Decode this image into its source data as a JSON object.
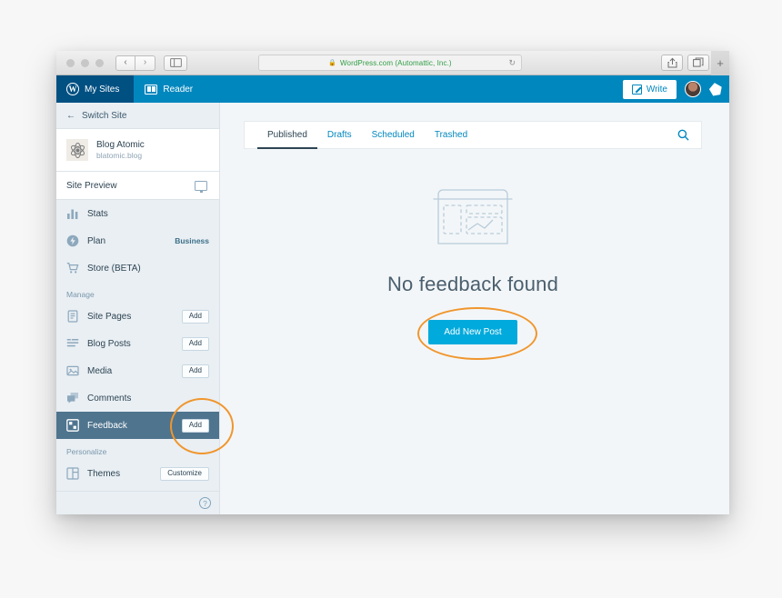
{
  "browser": {
    "url_text": "WordPress.com (Automattic, Inc.)",
    "lock_icon": "lock-icon",
    "reload_glyph": "↻",
    "back_glyph": "‹",
    "forward_glyph": "›",
    "new_tab_glyph": "+",
    "traffic_lights": [
      "close",
      "minimize",
      "zoom"
    ],
    "sidebar_toggle_icon": "sidebar-toggle-icon",
    "share_icon": "share-icon",
    "tabs_overview_icon": "tabs-overview-icon"
  },
  "masthead": {
    "my_sites_label": "My Sites",
    "reader_label": "Reader",
    "write_label": "Write",
    "wp_logo_glyph": "W",
    "avatar_name": "avatar",
    "notifications_name": "notifications-icon",
    "background_color": "#0087be",
    "active_background_color": "#005082"
  },
  "sidebar": {
    "switch_site_label": "Switch Site",
    "back_arrow_glyph": "←",
    "site": {
      "title": "Blog Atomic",
      "url": "blatomic.blog",
      "icon_name": "site-atom-icon"
    },
    "site_preview_label": "Site Preview",
    "primary_items": [
      {
        "label": "Stats",
        "icon": "stats-icon",
        "meta": ""
      },
      {
        "label": "Plan",
        "icon": "plan-icon",
        "meta": "Business"
      },
      {
        "label": "Store (BETA)",
        "icon": "store-icon",
        "meta": ""
      }
    ],
    "manage_section_label": "Manage",
    "manage_items": [
      {
        "label": "Site Pages",
        "icon": "page-icon",
        "action": "Add"
      },
      {
        "label": "Blog Posts",
        "icon": "posts-icon",
        "action": "Add"
      },
      {
        "label": "Media",
        "icon": "media-icon",
        "action": "Add"
      },
      {
        "label": "Comments",
        "icon": "comments-icon",
        "action": ""
      },
      {
        "label": "Feedback",
        "icon": "feedback-icon",
        "action": "Add"
      }
    ],
    "selected_item": "Feedback",
    "personalize_section_label": "Personalize",
    "personalize_items": [
      {
        "label": "Themes",
        "icon": "themes-icon",
        "action": "Customize"
      }
    ],
    "help_glyph": "?",
    "selected_background_color": "#4f748e"
  },
  "main": {
    "tabs": [
      {
        "label": "Published",
        "active": true
      },
      {
        "label": "Drafts",
        "active": false
      },
      {
        "label": "Scheduled",
        "active": false
      },
      {
        "label": "Trashed",
        "active": false
      }
    ],
    "search_icon": "search-icon",
    "empty_state": {
      "illustration_name": "empty-document-illustration",
      "title": "No feedback found",
      "button_label": "Add New Post",
      "button_color": "#00aadc"
    }
  },
  "annotations": {
    "accent_color": "#f0962d",
    "circles": [
      {
        "name": "annotation-circle-feedback-add"
      },
      {
        "name": "annotation-circle-add-new-post"
      }
    ]
  }
}
